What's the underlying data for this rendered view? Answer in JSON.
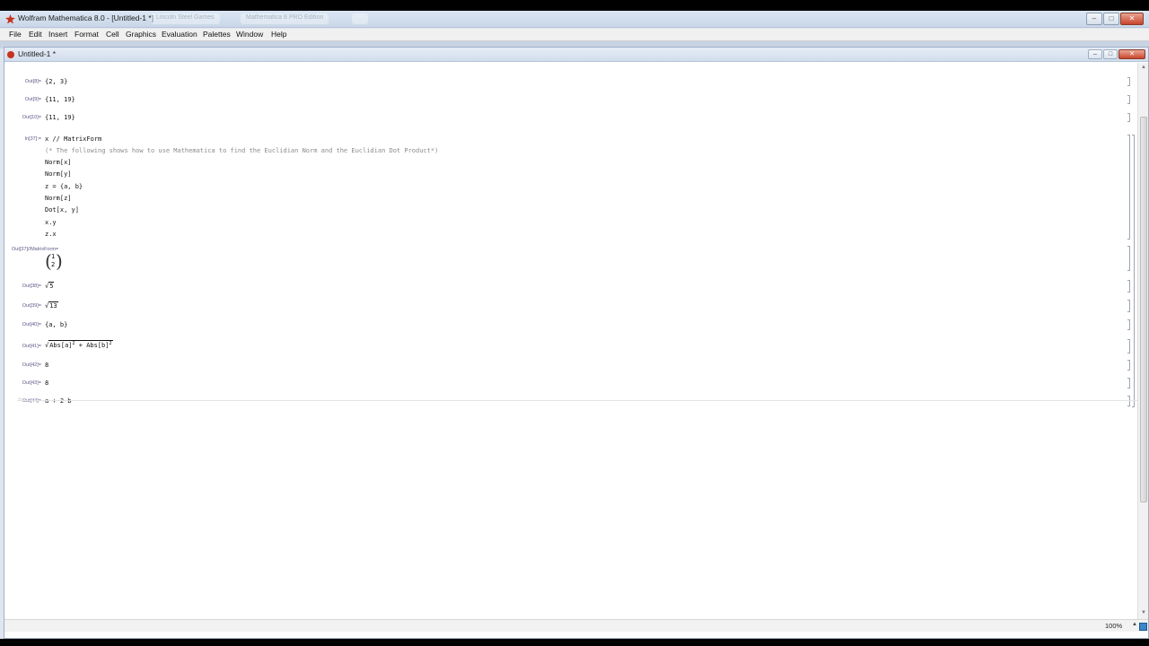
{
  "app": {
    "title": "Wolfram Mathematica 8.0 - [Untitled-1 *]",
    "ghost_tabs": [
      "Lincoln Steel Games",
      "Mathematica 8 PRO Edition",
      ""
    ],
    "window_controls": {
      "minimize": "–",
      "maximize": "□",
      "close": "✕"
    }
  },
  "menu": [
    "File",
    "Edit",
    "Insert",
    "Format",
    "Cell",
    "Graphics",
    "Evaluation",
    "Palettes",
    "Window",
    "Help"
  ],
  "document": {
    "title": "Untitled-1 *",
    "controls": {
      "minimize": "–",
      "maximize": "□",
      "close": "✕"
    }
  },
  "cells": {
    "out8": {
      "label": "Out[8]=",
      "value": "{2, 3}"
    },
    "out9": {
      "label": "Out[9]=",
      "value": "{11, 19}"
    },
    "out10": {
      "label": "Out[10]=",
      "value": "{11, 19}"
    },
    "in37": {
      "label": "In[37]:=",
      "lines": [
        "x // MatrixForm",
        "(* The following shows how to use Mathematica to find the Euclidian Norm and the Euclidian Dot Product*)",
        "Norm[x]",
        "Norm[y]",
        "z = {a, b}",
        "Norm[z]",
        "Dot[x, y]",
        "x.y",
        "z.x"
      ]
    },
    "out37": {
      "label": "Out[37]//MatrixForm=",
      "row1": "1",
      "row2": "2"
    },
    "out38": {
      "label": "Out[38]=",
      "radicand": "5"
    },
    "out39": {
      "label": "Out[39]=",
      "radicand": "13"
    },
    "out40": {
      "label": "Out[40]=",
      "value": "{a, b}"
    },
    "out41": {
      "label": "Out[41]=",
      "term1": "Abs[a]",
      "plus": " + ",
      "term2": "Abs[b]",
      "exp": "2"
    },
    "out42": {
      "label": "Out[42]=",
      "value": "8"
    },
    "out43": {
      "label": "Out[43]=",
      "value": "8"
    },
    "out44": {
      "label": "Out[44]=",
      "value": "a + 2 b"
    }
  },
  "status": {
    "zoom": "100%",
    "zoom_arrow": "▲"
  },
  "icons": {
    "sqrt": "√",
    "insertion_plus": "+",
    "scroll_up": "▲",
    "scroll_down": "▼"
  },
  "colors": {
    "accent_logo": "#c8321e",
    "cell_label": "#5b5b8a"
  }
}
